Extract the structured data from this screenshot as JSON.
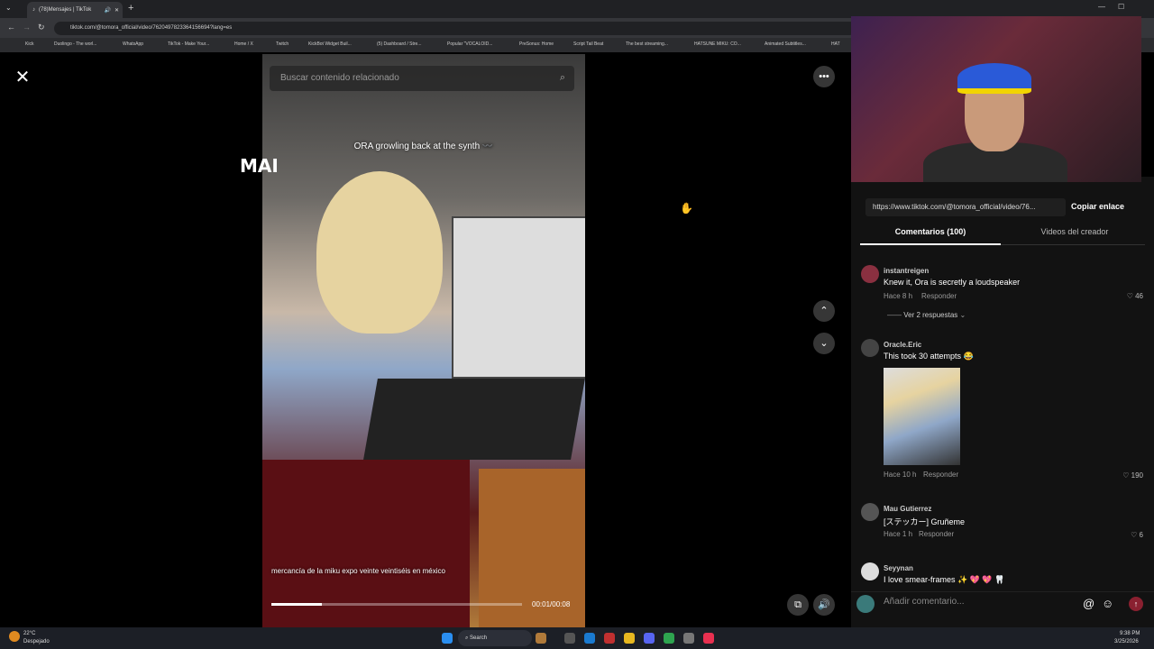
{
  "browser": {
    "tab_title": "(78)Mensajes | TikTok",
    "url": "tiktok.com/@tomora_official/video/7620497823364156694?lang=es",
    "bookmarks": [
      "Kick",
      "Duolingo - The worl...",
      "WhatsApp",
      "TikTok - Make Your...",
      "Home / X",
      "Twitch",
      "KickBot Widget Buil...",
      "(5) Dashboard / Stre...",
      "Popular \"VOCALOID...",
      "PreSonus: Home",
      "Script Tail Beat",
      "The best streaming...",
      "HATSUNE MIKU: CO...",
      "Animated Subtitles...",
      "HAT"
    ]
  },
  "video": {
    "search_placeholder": "Buscar contenido relacionado",
    "caption": "ORA growling back at the synth 〰️",
    "subtitle": "mercancía de la miku expo veinte veintiséis en méxico",
    "time": "00:01/00:08",
    "progress": 0.2
  },
  "side": {
    "link": "https://www.tiktok.com/@tomora_official/video/76...",
    "copy_label": "Copiar enlace",
    "tab_comments": "Comentarios (100)",
    "tab_creator": "Videos del creador",
    "comments": [
      {
        "user": "instantreigen",
        "text": "Knew it, Ora is secretly a loudspeaker",
        "time": "Hace 8 h",
        "reply": "Responder",
        "likes": "46",
        "more": "Ver 2 respuestas"
      },
      {
        "user": "Oracle.Eric",
        "text": "This took 30 attempts 😂",
        "time": "Hace 10 h",
        "reply": "Responder",
        "likes": "190"
      },
      {
        "user": "Mau Gutierrez",
        "text": "[ステッカー] Gruñeme",
        "time": "Hace 1 h",
        "reply": "Responder",
        "likes": "6"
      },
      {
        "user": "Seyynan",
        "text": "I love smear-frames ✨ 💖 💖 🦷"
      }
    ],
    "composer_placeholder": "Añadir comentario..."
  },
  "cam": {
    "overlay": "MAI"
  },
  "taskbar": {
    "weather_temp": "22°C",
    "weather_desc": "Despejado",
    "search": "Search",
    "time": "9:38 PM",
    "date": "3/25/2026"
  }
}
